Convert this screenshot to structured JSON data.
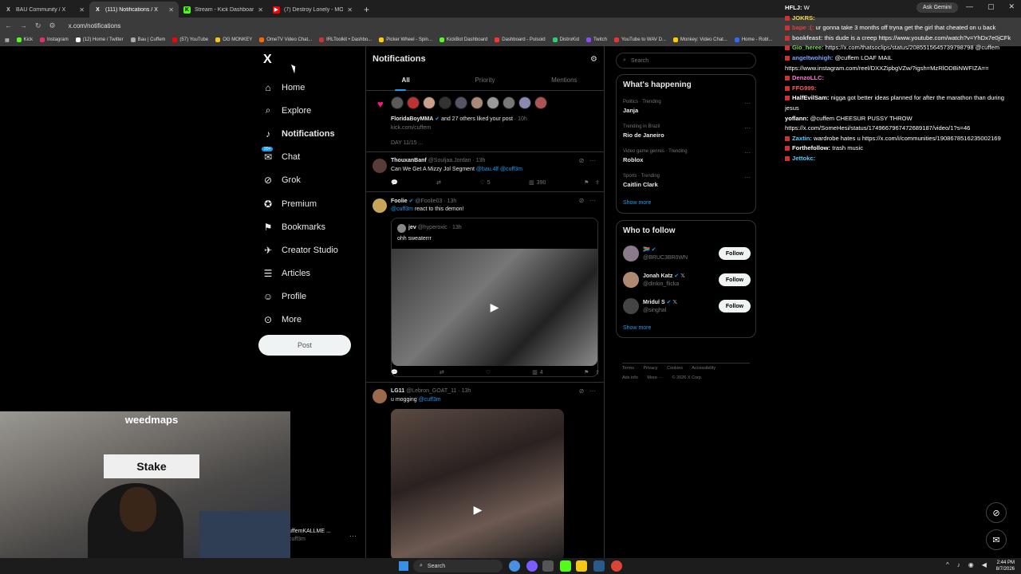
{
  "browser": {
    "tabs": [
      {
        "title": "BAU Community / X",
        "icon": "x-icon",
        "active": false
      },
      {
        "title": "(111) Notifications / X",
        "icon": "x-icon",
        "active": true
      },
      {
        "title": "Stream - Kick Dashboard",
        "icon": "kick-icon",
        "active": false
      },
      {
        "title": "(7) Destroy Lonely - MONST...",
        "icon": "youtube-icon",
        "active": false
      }
    ],
    "gemini_label": "Ask Gemini",
    "url": "x.com/notifications",
    "bookmarks": [
      "Kick",
      "Instagram",
      "(12) Home / Twitter",
      "Bau | Cuffem",
      "(57) YouTube",
      "OG MONKEY",
      "OmeTV Video Chat...",
      "IRLToolkit • Dashbo...",
      "Picker Wheel - Spin...",
      "KickBot Dashboard",
      "Dashboard - Pulsoid",
      "DistroKid",
      "Twitch",
      "YouTube to WAV D...",
      "Monkey: Video Chat...",
      "Home - Robl..."
    ]
  },
  "x": {
    "logo": "X",
    "nav": [
      {
        "label": "Home",
        "icon": "home-icon",
        "glyph": "⌂",
        "bold": false
      },
      {
        "label": "Explore",
        "icon": "search-icon",
        "glyph": "⌕",
        "bold": false
      },
      {
        "label": "Notifications",
        "icon": "bell-icon",
        "glyph": "🔔",
        "bold": true
      },
      {
        "label": "Chat",
        "icon": "mail-icon",
        "glyph": "✉",
        "bold": false,
        "badge": "20+"
      },
      {
        "label": "Grok",
        "icon": "grok-icon",
        "glyph": "⊘",
        "bold": false
      },
      {
        "label": "Premium",
        "icon": "premium-icon",
        "glyph": "✪",
        "bold": false
      },
      {
        "label": "Bookmarks",
        "icon": "bookmark-icon",
        "glyph": "⚑",
        "bold": false
      },
      {
        "label": "Creator Studio",
        "icon": "creator-studio-icon",
        "glyph": "✈",
        "bold": false
      },
      {
        "label": "Articles",
        "icon": "articles-icon",
        "glyph": "☰",
        "bold": false
      },
      {
        "label": "Profile",
        "icon": "profile-icon",
        "glyph": "☺",
        "bold": false
      },
      {
        "label": "More",
        "icon": "more-icon",
        "glyph": "⋯",
        "bold": false
      }
    ],
    "post_button": "Post",
    "account": {
      "name": "uffemKALLME ...",
      "handle": "cuff3m"
    }
  },
  "notifications": {
    "title": "Notifications",
    "tabs": [
      "All",
      "Priority",
      "Mentions"
    ],
    "like_notice": {
      "user": "FloridaBoyMMA",
      "rest": "and 27 others liked your post",
      "time": "· 10h",
      "link": "kick.com/cuffem",
      "day": "DAY 11/15 ..."
    },
    "posts": [
      {
        "name": "ThouxanBanf",
        "handle": "@Souljaa.Jordan · 13h",
        "text": "Can We Get A Mizzy Jol Segment",
        "mentions": "@bau.4lf @cuff3m",
        "replies": "",
        "reposts": "",
        "likes": "5",
        "views": "390"
      },
      {
        "name": "Foolie",
        "handle": "@Foolie03 · 13h",
        "mention": "@cuff3m",
        "text": "react to this demon!",
        "quote": {
          "name": "jev",
          "handle": "@hyperoxic · 13h",
          "text": "ohh sweaterrr"
        },
        "likes": "",
        "views": "4"
      },
      {
        "name": "LG11",
        "handle": "@Lebron_GOAT_11 · 13h",
        "text": "u mogging",
        "mention": "@cuff3m"
      }
    ]
  },
  "sidebar": {
    "search_placeholder": "Search",
    "happening_title": "What's happening",
    "trends": [
      {
        "category": "Politics · Trending",
        "name": "Janja"
      },
      {
        "category": "Trending in Brazil",
        "name": "Rio de Janeiro"
      },
      {
        "category": "Video game genres · Trending",
        "name": "Roblox"
      },
      {
        "category": "Sports · Trending",
        "name": "Caitlin Clark"
      }
    ],
    "show_more": "Show more",
    "wtf_title": "Who to follow",
    "follow_suggestions": [
      {
        "name": "🇿🇦",
        "handle": "@BRUC3BR0WN",
        "button": "Follow"
      },
      {
        "name": "Jonah Katz",
        "handle": "@dinkin_flicka",
        "button": "Follow"
      },
      {
        "name": "Mridul S",
        "handle": "@singhal",
        "button": "Follow"
      }
    ],
    "footer": [
      "Terms",
      "Privacy",
      "Cookies",
      "Accessibility",
      "Ads info",
      "More ···",
      "© 2026 X Corp."
    ]
  },
  "chat": [
    {
      "user": "HFLJ:",
      "text": "W",
      "color": "#ffffff"
    },
    {
      "user": "JOKRS:",
      "text": "",
      "color": "#f5d742"
    },
    {
      "user": "bape :(:",
      "text": "ur gonna take 3 months off tryna get the girl that cheated on u back",
      "color": "#e0403a"
    },
    {
      "user": "bookfeast:",
      "text": "this dude is a creep https://www.youtube.com/watch?v=YhDx7e0jCFk",
      "color": "#d9d9d9"
    },
    {
      "user": "Gio_heree:",
      "text": "https://x.com/thatsoclips/status/2085515645739798798 @cuffem",
      "color": "#7ed957"
    },
    {
      "user": "angeltwohigh:",
      "text": "@cuffem LOAF MAIL https://www.instagram.com/reel/DXXZipbgVZw/?igsh=MzRlODBiNWFIZA==",
      "color": "#7aa5ff"
    },
    {
      "user": "DenzoLLC:",
      "text": "",
      "color": "#ff7ad9"
    },
    {
      "user": "FFG999:",
      "text": "",
      "color": "#ff5c5c"
    },
    {
      "user": "HalfEvilSam:",
      "text": "nigga got better ideas planned for after the marathon than during jesus",
      "color": "#ffffff"
    },
    {
      "user": "yoflann:",
      "text": "@cuffem CHEESUR PUSSY THROW https://x.com/SomeHesi/status/1749667967472689187/video/1?s=46",
      "color": "#ffffff"
    },
    {
      "user": "Zaxtin:",
      "text": "wardrobe hates u https://x.com/i/communities/1908678516235002169",
      "color": "#4fd1ff"
    },
    {
      "user": "Forthefollow:",
      "text": "trash music",
      "color": "#ffffff"
    },
    {
      "user": "Jettokc:",
      "text": "",
      "color": "#4fd1ff"
    }
  ],
  "webcam": {
    "sign": "weedmaps",
    "sign2": "Stake"
  },
  "taskbar": {
    "search": "Search",
    "time": "2:44 PM",
    "date": "8/7/2026"
  }
}
